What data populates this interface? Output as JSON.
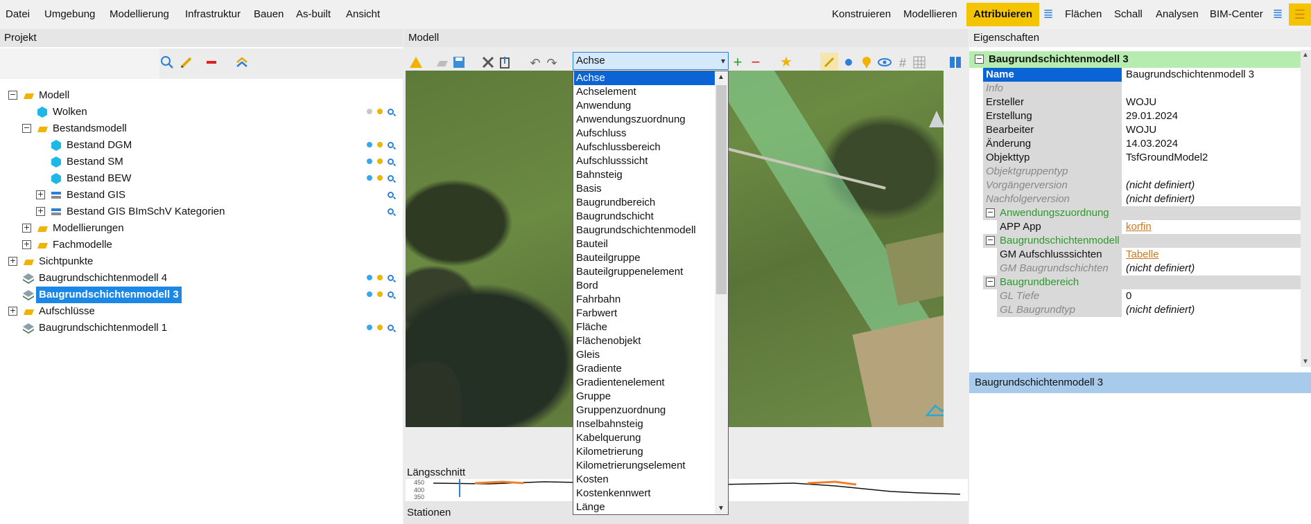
{
  "menubar": {
    "left_items": [
      "Datei",
      "Umgebung",
      "Modellierung",
      "Infrastruktur",
      "Bauen",
      "As-built",
      "Ansicht"
    ],
    "right_items": [
      "Konstruieren",
      "Modellieren",
      "Attribuieren",
      "Flächen",
      "Schall",
      "Analysen",
      "BIM-Center"
    ],
    "active_item": "Attribuieren",
    "accent_color": "#f5c400"
  },
  "project": {
    "title": "Projekt",
    "tree": [
      {
        "label": "Modell",
        "icon": "folder-icon",
        "toggle": "−"
      },
      {
        "label": "Wolken",
        "icon": "hexagon-icon",
        "toggle": ""
      },
      {
        "label": "Bestandsmodell",
        "icon": "folder-icon",
        "toggle": "−"
      },
      {
        "label": "Bestand DGM",
        "icon": "hexagon-icon",
        "toggle": ""
      },
      {
        "label": "Bestand SM",
        "icon": "hexagon-icon",
        "toggle": ""
      },
      {
        "label": "Bestand BEW",
        "icon": "hexagon-icon",
        "toggle": ""
      },
      {
        "label": "Bestand GIS",
        "icon": "gis-layer-icon",
        "toggle": "+"
      },
      {
        "label": "Bestand GIS BImSchV Kategorien",
        "icon": "gis-layer-icon",
        "toggle": "+"
      },
      {
        "label": "Modellierungen",
        "icon": "folder-icon",
        "toggle": "+"
      },
      {
        "label": "Fachmodelle",
        "icon": "folder-icon",
        "toggle": "+"
      },
      {
        "label": "Sichtpunkte",
        "icon": "folder-icon",
        "toggle": "+"
      },
      {
        "label": "Baugrundschichtenmodell 4",
        "icon": "layers-icon",
        "toggle": ""
      },
      {
        "label": "Baugrundschichtenmodell 3",
        "icon": "layers-icon",
        "toggle": ""
      },
      {
        "label": "Aufschlüsse",
        "icon": "folder-icon",
        "toggle": "+"
      },
      {
        "label": "Baugrundschichtenmodell 1",
        "icon": "layers-icon",
        "toggle": ""
      }
    ],
    "selected": "Baugrundschichtenmodell 3"
  },
  "model": {
    "title": "Modell",
    "type_select": {
      "value": "Achse",
      "options": [
        "Achse",
        "Achselement",
        "Anwendung",
        "Anwendungszuordnung",
        "Aufschluss",
        "Aufschlussbereich",
        "Aufschlusssicht",
        "Bahnsteig",
        "Basis",
        "Baugrundbereich",
        "Baugrundschicht",
        "Baugrundschichtenmodell",
        "Bauteil",
        "Bauteilgruppe",
        "Bauteilgruppenelement",
        "Bord",
        "Fahrbahn",
        "Farbwert",
        "Fläche",
        "Flächenobjekt",
        "Gleis",
        "Gradiente",
        "Gradientenelement",
        "Gruppe",
        "Gruppenzuordnung",
        "Inselbahnsteig",
        "Kabelquerung",
        "Kilometrierung",
        "Kilometrierungselement",
        "Kosten",
        "Kostenkennwert",
        "Länge"
      ]
    }
  },
  "profile": {
    "title": "Längsschnitt",
    "ticks": [
      "450",
      "400",
      "350"
    ]
  },
  "stations": {
    "title": "Stationen"
  },
  "properties": {
    "title": "Eigenschaften",
    "header": "Baugrundschichtenmodell 3",
    "rows": [
      {
        "key": "Name",
        "value": "Baugrundschichtenmodell 3"
      },
      {
        "key": "Info",
        "value": ""
      },
      {
        "key": "Ersteller",
        "value": "WOJU"
      },
      {
        "key": "Erstellung",
        "value": "29.01.2024"
      },
      {
        "key": "Bearbeiter",
        "value": "WOJU"
      },
      {
        "key": "Änderung",
        "value": "14.03.2024"
      },
      {
        "key": "Objekttyp",
        "value": "TsfGroundModel2"
      },
      {
        "key": "Objektgruppentyp",
        "value": ""
      },
      {
        "key": "Vorgängerversion",
        "value": "(nicht definiert)"
      },
      {
        "key": "Nachfolgerversion",
        "value": "(nicht definiert)"
      }
    ],
    "groups": [
      {
        "title": "Anwendungszuordnung",
        "rows": [
          {
            "key": "APP App",
            "value": "korfin"
          }
        ]
      },
      {
        "title": "Baugrundschichtenmodell",
        "rows": [
          {
            "key": "GM Aufschlusssichten",
            "value": "Tabelle"
          },
          {
            "key": "GM Baugrundschichten",
            "value": "(nicht definiert)"
          }
        ]
      },
      {
        "title": "Baugrundbereich",
        "rows": [
          {
            "key": "GL Tiefe",
            "value": "0"
          },
          {
            "key": "GL Baugrundtyp",
            "value": "(nicht definiert)"
          }
        ]
      }
    ],
    "selection_label": "Baugrundschichtenmodell 3"
  }
}
